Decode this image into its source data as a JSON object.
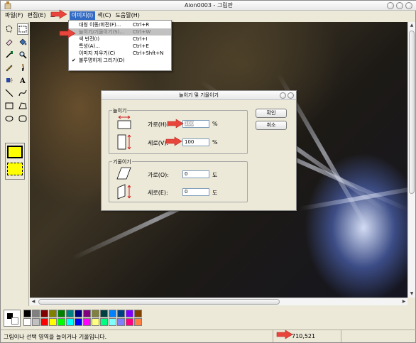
{
  "window": {
    "title": "Aion0003 - 그림판"
  },
  "menubar": {
    "items": [
      {
        "label": "파일(F)"
      },
      {
        "label": "편집(E)"
      },
      {
        "label": "보"
      },
      {
        "label": "이미지(I)"
      },
      {
        "label": "색(C)"
      },
      {
        "label": "도움말(H)"
      }
    ]
  },
  "image_menu": {
    "items": [
      {
        "label": "대칭 이동/회전(F)...",
        "shortcut": "Ctrl+R"
      },
      {
        "label": "늘이기/기울이기(S)...",
        "shortcut": "Ctrl+W"
      },
      {
        "label": "색 반전(I)",
        "shortcut": "Ctrl+I"
      },
      {
        "label": "특성(A)...",
        "shortcut": "Ctrl+E"
      },
      {
        "label": "이미지 지우기(C)",
        "shortcut": "Ctrl+Shft+N"
      },
      {
        "label": "불투명하게 그리기(D)",
        "shortcut": "",
        "checked": true
      }
    ]
  },
  "dialog": {
    "title": "늘이기 및 기울이기",
    "stretch_group": "늘이기",
    "horizontal_label": "가로(H):",
    "horizontal_value": "100",
    "vertical_label": "세로(V):",
    "vertical_value": "100",
    "percent": "%",
    "skew_group": "기울이기",
    "skew_h_label": "가로(O):",
    "skew_h_value": "0",
    "skew_v_label": "세로(E):",
    "skew_v_value": "0",
    "degree": "도",
    "ok": "확인",
    "cancel": "취소"
  },
  "status": {
    "text": "그림이나 선택 영역을 늘이거나 기울입니다.",
    "coords": "710,521"
  },
  "palette": {
    "colors": [
      "#000000",
      "#808080",
      "#800000",
      "#808000",
      "#008000",
      "#008080",
      "#000080",
      "#800080",
      "#808040",
      "#004040",
      "#0080ff",
      "#004080",
      "#8000ff",
      "#804000",
      "#ffffff",
      "#c0c0c0",
      "#ff0000",
      "#ffff00",
      "#00ff00",
      "#00ffff",
      "#0000ff",
      "#ff00ff",
      "#ffff80",
      "#00ff80",
      "#80ffff",
      "#8080ff",
      "#ff0080",
      "#ff8040"
    ]
  },
  "colors": {
    "menu_highlight": "#316ac5",
    "annotation_arrow": "#e8453c"
  }
}
